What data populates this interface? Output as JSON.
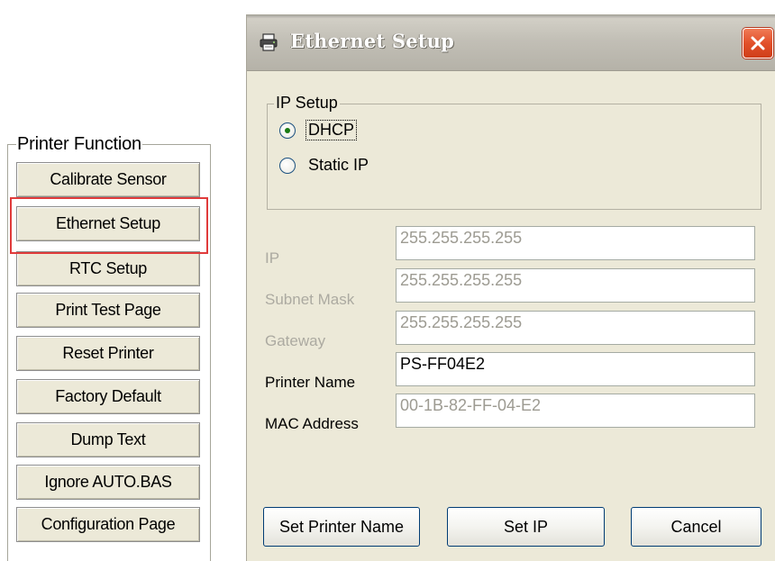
{
  "printer_function": {
    "legend": "Printer Function",
    "buttons": [
      "Calibrate Sensor",
      "Ethernet Setup",
      "RTC Setup",
      "Print Test Page",
      "Reset Printer",
      "Factory Default",
      "Dump Text",
      "Ignore AUTO.BAS",
      "Configuration Page"
    ],
    "highlight_color": "#e03b3b"
  },
  "dialog": {
    "title": "Ethernet Setup",
    "title_icon": "printer-icon",
    "close_icon": "close-icon",
    "ip_setup": {
      "legend": "IP Setup",
      "options": [
        {
          "label": "DHCP",
          "checked": true
        },
        {
          "label": "Static IP",
          "checked": false
        }
      ]
    },
    "fields": {
      "ip": {
        "label": "IP",
        "value": "255.255.255.255",
        "enabled": false
      },
      "subnet": {
        "label": "Subnet Mask",
        "value": "255.255.255.255",
        "enabled": false
      },
      "gateway": {
        "label": "Gateway",
        "value": "255.255.255.255",
        "enabled": false
      },
      "printer_name": {
        "label": "Printer Name",
        "value": "PS-FF04E2",
        "enabled": true
      },
      "mac": {
        "label": "MAC Address",
        "value": "00-1B-82-FF-04-E2",
        "enabled": false
      }
    },
    "buttons": {
      "set_printer_name": "Set Printer Name",
      "set_ip": "Set IP",
      "cancel": "Cancel"
    }
  },
  "colors": {
    "dialog_bg": "#ece9d8",
    "close_button": "#e2502a",
    "button_border": "#003c74"
  }
}
